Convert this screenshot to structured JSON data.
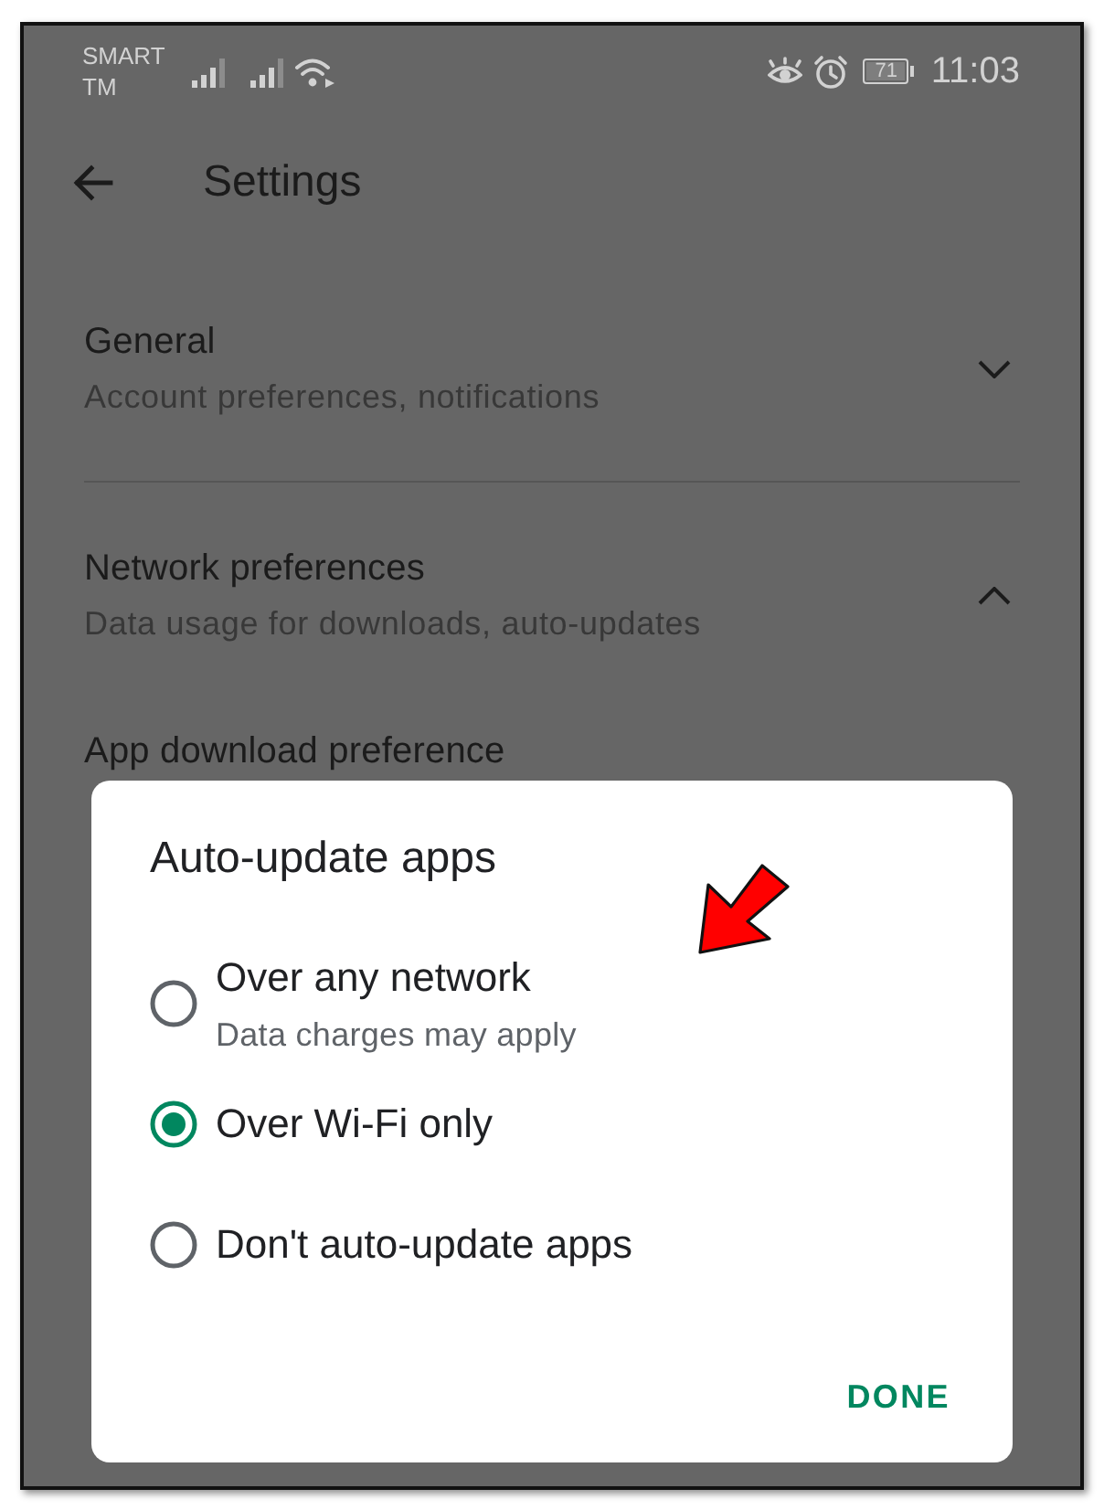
{
  "status_bar": {
    "carrier": "SMART TM",
    "battery": "71",
    "time": "11:03"
  },
  "app_bar": {
    "title": "Settings"
  },
  "sections": [
    {
      "title": "General",
      "subtitle": "Account preferences, notifications",
      "expanded": false
    },
    {
      "title": "Network preferences",
      "subtitle": "Data usage for downloads, auto-updates",
      "expanded": true,
      "items": [
        {
          "title": "App download preference"
        }
      ]
    }
  ],
  "dialog": {
    "title": "Auto-update apps",
    "options": [
      {
        "label": "Over any network",
        "description": "Data charges may apply",
        "selected": false
      },
      {
        "label": "Over Wi-Fi only",
        "selected": true
      },
      {
        "label": "Don't auto-update apps",
        "selected": false
      }
    ],
    "buttons": [
      "DONE"
    ]
  }
}
